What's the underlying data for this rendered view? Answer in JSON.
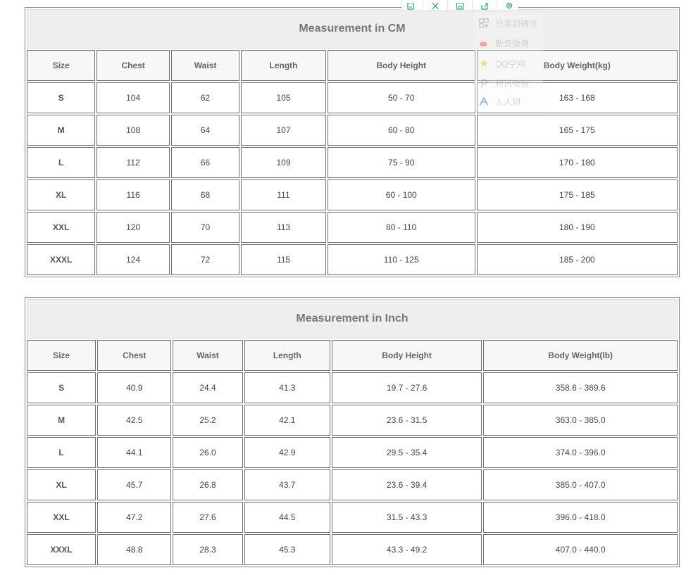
{
  "toolbar": {
    "icons": [
      "copy-icon",
      "crop-icon",
      "save-icon",
      "share-icon",
      "settings-icon"
    ]
  },
  "share_menu": {
    "items": [
      {
        "label": "分享到微信",
        "icon": "wechat-icon"
      },
      {
        "label": "新浪微博",
        "icon": "weibo-icon"
      },
      {
        "label": "QQ空间",
        "icon": "qzone-icon"
      },
      {
        "label": "腾讯微博",
        "icon": "tencent-weibo-icon"
      },
      {
        "label": "人人网",
        "icon": "renren-icon"
      }
    ]
  },
  "cm_table": {
    "title": "Measurement in CM",
    "headers": [
      "Size",
      "Chest",
      "Waist",
      "Length",
      "Body Height",
      "Body Weight(kg)"
    ],
    "rows": [
      [
        "S",
        "104",
        "62",
        "105",
        "50 - 70",
        "163 - 168"
      ],
      [
        "M",
        "108",
        "64",
        "107",
        "60 - 80",
        "165 - 175"
      ],
      [
        "L",
        "112",
        "66",
        "109",
        "75 - 90",
        "170 - 180"
      ],
      [
        "XL",
        "116",
        "68",
        "111",
        "60 - 100",
        "175 - 185"
      ],
      [
        "XXL",
        "120",
        "70",
        "113",
        "80 - 110",
        "180 - 190"
      ],
      [
        "XXXL",
        "124",
        "72",
        "115",
        "110 - 125",
        "185 - 200"
      ]
    ]
  },
  "inch_table": {
    "title": "Measurement in Inch",
    "headers": [
      "Size",
      "Chest",
      "Waist",
      "Length",
      "Body Height",
      "Body Weight(lb)"
    ],
    "rows": [
      [
        "S",
        "40.9",
        "24.4",
        "41.3",
        "19.7 - 27.6",
        "358.6 - 369.6"
      ],
      [
        "M",
        "42.5",
        "25.2",
        "42.1",
        "23.6 - 31.5",
        "363.0 - 385.0"
      ],
      [
        "L",
        "44.1",
        "26.0",
        "42.9",
        "29.5 - 35.4",
        "374.0 - 396.0"
      ],
      [
        "XL",
        "45.7",
        "26.8",
        "43.7",
        "23.6 - 39.4",
        "385.0 - 407.0"
      ],
      [
        "XXL",
        "47.2",
        "27.6",
        "44.5",
        "31.5 - 43.3",
        "396.0 - 418.0"
      ],
      [
        "XXXL",
        "48.8",
        "28.3",
        "45.3",
        "43.3 - 49.2",
        "407.0 - 440.0"
      ]
    ]
  }
}
